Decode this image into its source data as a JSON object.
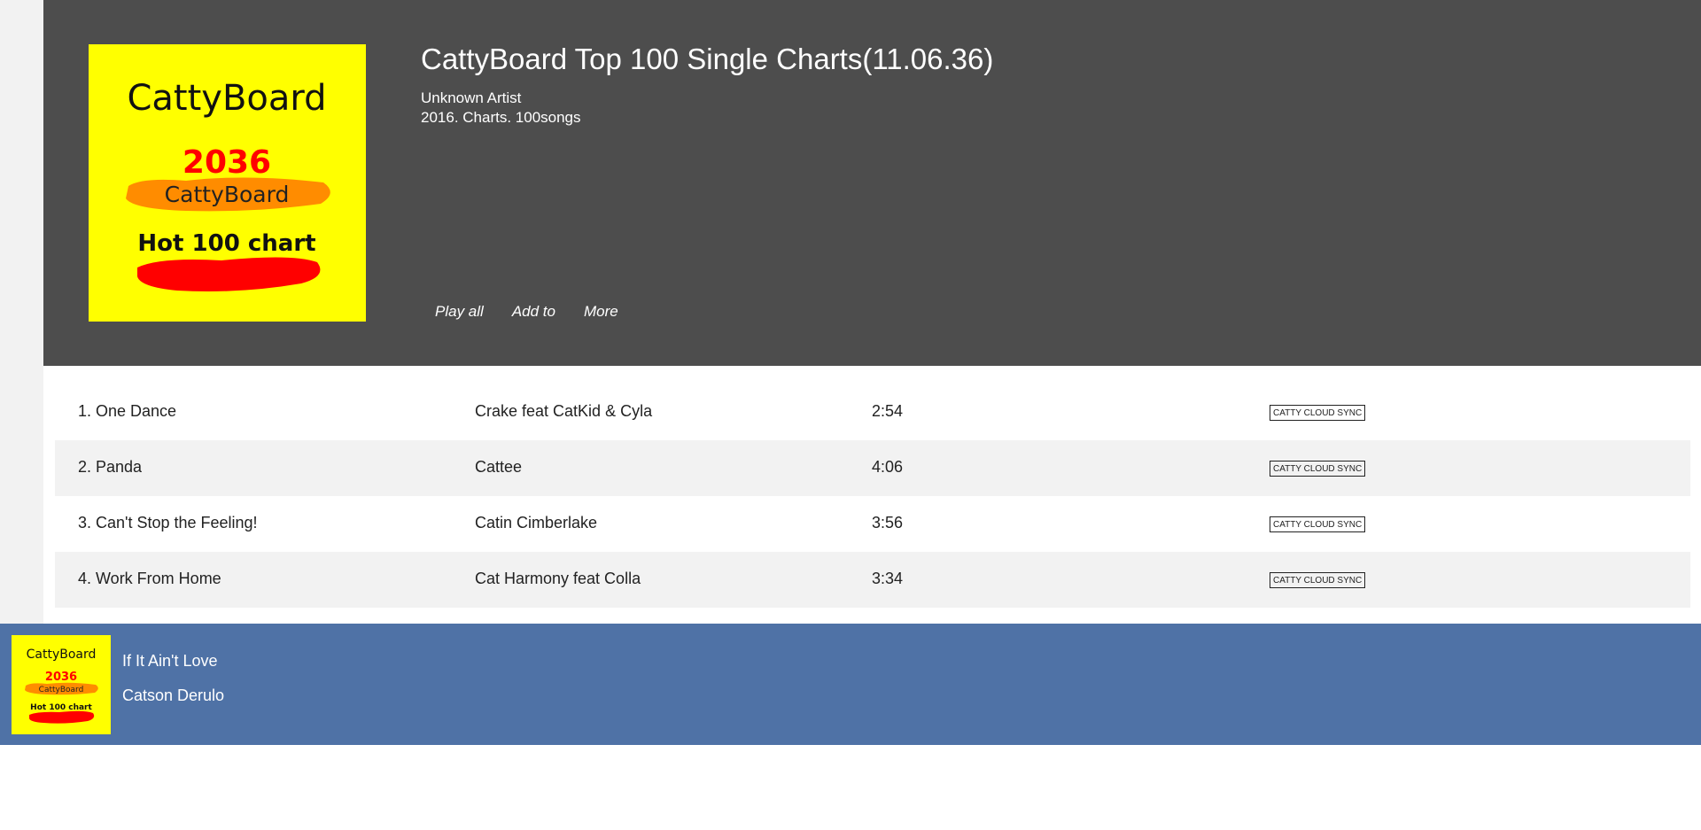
{
  "album": {
    "title": "CattyBoard Top 100 Single Charts(11.06.36)",
    "artist": "Unknown Artist",
    "meta": "2016. Charts. 100songs",
    "cover": {
      "brand": "CattyBoard",
      "year": "2036",
      "subbrand": "CattyBoard",
      "chart": "Hot 100 chart"
    }
  },
  "actions": {
    "play_all": "Play all",
    "add_to": "Add to",
    "more": "More"
  },
  "tracks": [
    {
      "title": "1. One Dance",
      "artist": "Crake feat CatKid & Cyla",
      "duration": "2:54",
      "sync": "CATTY CLOUD SYNC"
    },
    {
      "title": "2. Panda",
      "artist": "Cattee",
      "duration": "4:06",
      "sync": "CATTY CLOUD SYNC"
    },
    {
      "title": "3. Can't Stop the Feeling!",
      "artist": "Catin Cimberlake",
      "duration": "3:56",
      "sync": "CATTY CLOUD SYNC"
    },
    {
      "title": "4. Work From Home",
      "artist": "Cat Harmony feat Colla",
      "duration": "3:34",
      "sync": "CATTY CLOUD SYNC"
    }
  ],
  "now_playing": {
    "title": "If It Ain't Love",
    "artist": "Catson Derulo",
    "cover": {
      "brand": "CattyBoard",
      "year": "2036",
      "subbrand": "CattyBoard",
      "chart": "Hot 100 chart"
    }
  },
  "colors": {
    "header_bg": "#4d4d4d",
    "player_bg": "#4f72a6",
    "cover_bg": "#ffff00",
    "cover_year": "#ff0000",
    "cover_stroke_orange": "#ff8c00",
    "cover_stroke_red": "#ff0000"
  }
}
